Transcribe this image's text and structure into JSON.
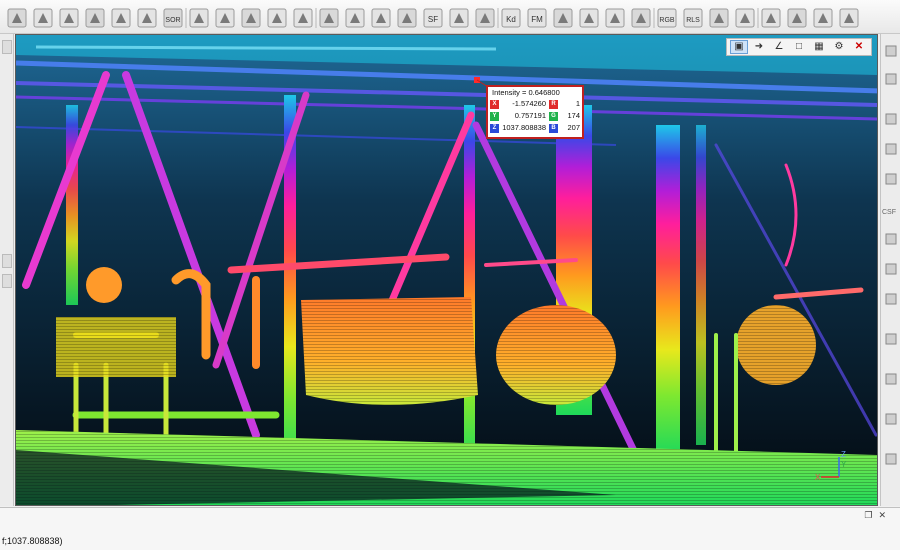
{
  "toolbar": {
    "items": [
      {
        "icon": "clone-icon"
      },
      {
        "icon": "merge-icon"
      },
      {
        "icon": "align-icon"
      },
      {
        "icon": "fine-register-icon"
      },
      {
        "icon": "subsample-icon"
      },
      {
        "icon": "checker-icon"
      },
      {
        "icon": "sor-filter-icon",
        "text": "SOR"
      },
      {
        "icon": "normals-icon"
      },
      {
        "icon": "transform-icon"
      },
      {
        "icon": "segment-icon"
      },
      {
        "icon": "crop-icon"
      },
      {
        "icon": "histogram-icon"
      },
      {
        "icon": "scalar-field-icon"
      },
      {
        "icon": "filter-icon"
      },
      {
        "icon": "add-icon"
      },
      {
        "icon": "gradient-icon"
      },
      {
        "icon": "sf-arithmetic-icon",
        "text": "SF"
      },
      {
        "icon": "compute-cloud-icon"
      },
      {
        "icon": "compute-mesh-icon"
      },
      {
        "icon": "kd-tree-icon",
        "text": "Kd"
      },
      {
        "icon": "fm-icon",
        "text": "FM"
      },
      {
        "icon": "disk-icon"
      },
      {
        "icon": "c2c-icon"
      },
      {
        "icon": "sphere-icon"
      },
      {
        "icon": "register-icon"
      },
      {
        "icon": "rgb-icon",
        "text": "RGB"
      },
      {
        "icon": "rcs-icon",
        "text": "RLS"
      },
      {
        "icon": "plugin-a-icon"
      },
      {
        "icon": "plugin-b-icon"
      },
      {
        "icon": "terrain-a-icon"
      },
      {
        "icon": "terrain-b-icon"
      },
      {
        "icon": "terrain-c-icon"
      },
      {
        "icon": "terrain-d-icon"
      }
    ]
  },
  "viewport_toolbar": {
    "buttons": [
      "point-picking-icon",
      "distance-icon",
      "angle-icon",
      "crop-area-icon",
      "save-label-icon",
      "settings-icon",
      "close-icon"
    ]
  },
  "point_label": {
    "title": "Intensity = 0.646800",
    "coords": {
      "x_letter": "X",
      "x": "-1.574260",
      "y_letter": "Y",
      "y": "0.757191",
      "z_letter": "Z",
      "z": "1037.808838"
    },
    "rgb": {
      "r_letter": "R",
      "r": "1",
      "g_letter": "G",
      "g": "174",
      "b_letter": "B",
      "b": "207"
    }
  },
  "axes": {
    "x_label": "X",
    "y_label": "Y",
    "z_label": "Z"
  },
  "colors": {
    "background_top": "#1a5f8a",
    "background_bottom": "#04101a",
    "label_border": "#c0201f",
    "scalar_ramp": [
      "#22d95a",
      "#e8e81c",
      "#ff7a1e",
      "#ff1e8c",
      "#b21ed8",
      "#2a48e8",
      "#1ec8e8"
    ]
  },
  "right_dock": {
    "section_label": "CSF"
  },
  "console": {
    "line": "f;1037.808838)"
  }
}
